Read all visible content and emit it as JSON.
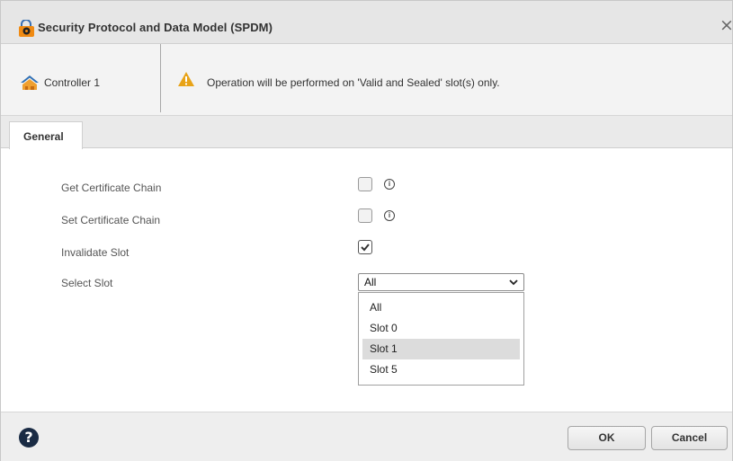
{
  "dialog": {
    "title": "Security Protocol and Data Model (SPDM)",
    "close_symbol": "×",
    "title_icon": "lock-shield-icon"
  },
  "header": {
    "controller_label": "Controller 1",
    "controller_icon": "controller-icon",
    "warning_icon": "warning-icon",
    "warning_text": "Operation will be performed on 'Valid and Sealed' slot(s) only."
  },
  "tabs": [
    {
      "label": "General",
      "active": true
    }
  ],
  "form": {
    "fields": [
      {
        "label": "Get Certificate Chain",
        "type": "checkbox",
        "checked": false,
        "info": true
      },
      {
        "label": "Set Certificate Chain",
        "type": "checkbox",
        "checked": false,
        "info": true
      },
      {
        "label": "Invalidate Slot",
        "type": "checkbox",
        "checked": true,
        "info": false
      },
      {
        "label": "Select Slot",
        "type": "select"
      }
    ],
    "info_symbol": "ⓘ",
    "select": {
      "value": "All",
      "options": [
        "All",
        "Slot 0",
        "Slot 1",
        "Slot 5"
      ],
      "highlighted": "Slot 1"
    }
  },
  "footer": {
    "help_symbol": "?",
    "ok_label": "OK",
    "cancel_label": "Cancel"
  },
  "colors": {
    "titlebar_bg": "#e6e6e6",
    "header_bg": "#f3f3f3",
    "warning": "#e8a317",
    "help_bg": "#1a2b44"
  }
}
